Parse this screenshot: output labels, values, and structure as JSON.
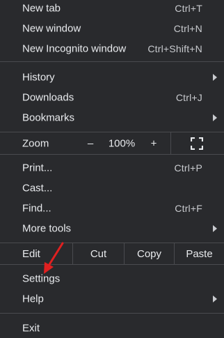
{
  "menu": {
    "new_tab": {
      "label": "New tab",
      "shortcut": "Ctrl+T"
    },
    "new_window": {
      "label": "New window",
      "shortcut": "Ctrl+N"
    },
    "new_incognito": {
      "label": "New Incognito window",
      "shortcut": "Ctrl+Shift+N"
    },
    "history": {
      "label": "History"
    },
    "downloads": {
      "label": "Downloads",
      "shortcut": "Ctrl+J"
    },
    "bookmarks": {
      "label": "Bookmarks"
    },
    "zoom": {
      "label": "Zoom",
      "minus": "–",
      "value": "100%",
      "plus": "+"
    },
    "print": {
      "label": "Print...",
      "shortcut": "Ctrl+P"
    },
    "cast": {
      "label": "Cast..."
    },
    "find": {
      "label": "Find...",
      "shortcut": "Ctrl+F"
    },
    "more_tools": {
      "label": "More tools"
    },
    "edit": {
      "label": "Edit",
      "cut": "Cut",
      "copy": "Copy",
      "paste": "Paste"
    },
    "settings": {
      "label": "Settings"
    },
    "help": {
      "label": "Help"
    },
    "exit": {
      "label": "Exit"
    }
  },
  "colors": {
    "background": "#292a2d",
    "text": "#e8eaed",
    "separator": "#4a4b4f",
    "annotation_arrow": "#e02020"
  },
  "icons": {
    "fullscreen": "fullscreen-icon",
    "submenu": "chevron-right-icon",
    "annotation": "red-arrow-icon"
  }
}
